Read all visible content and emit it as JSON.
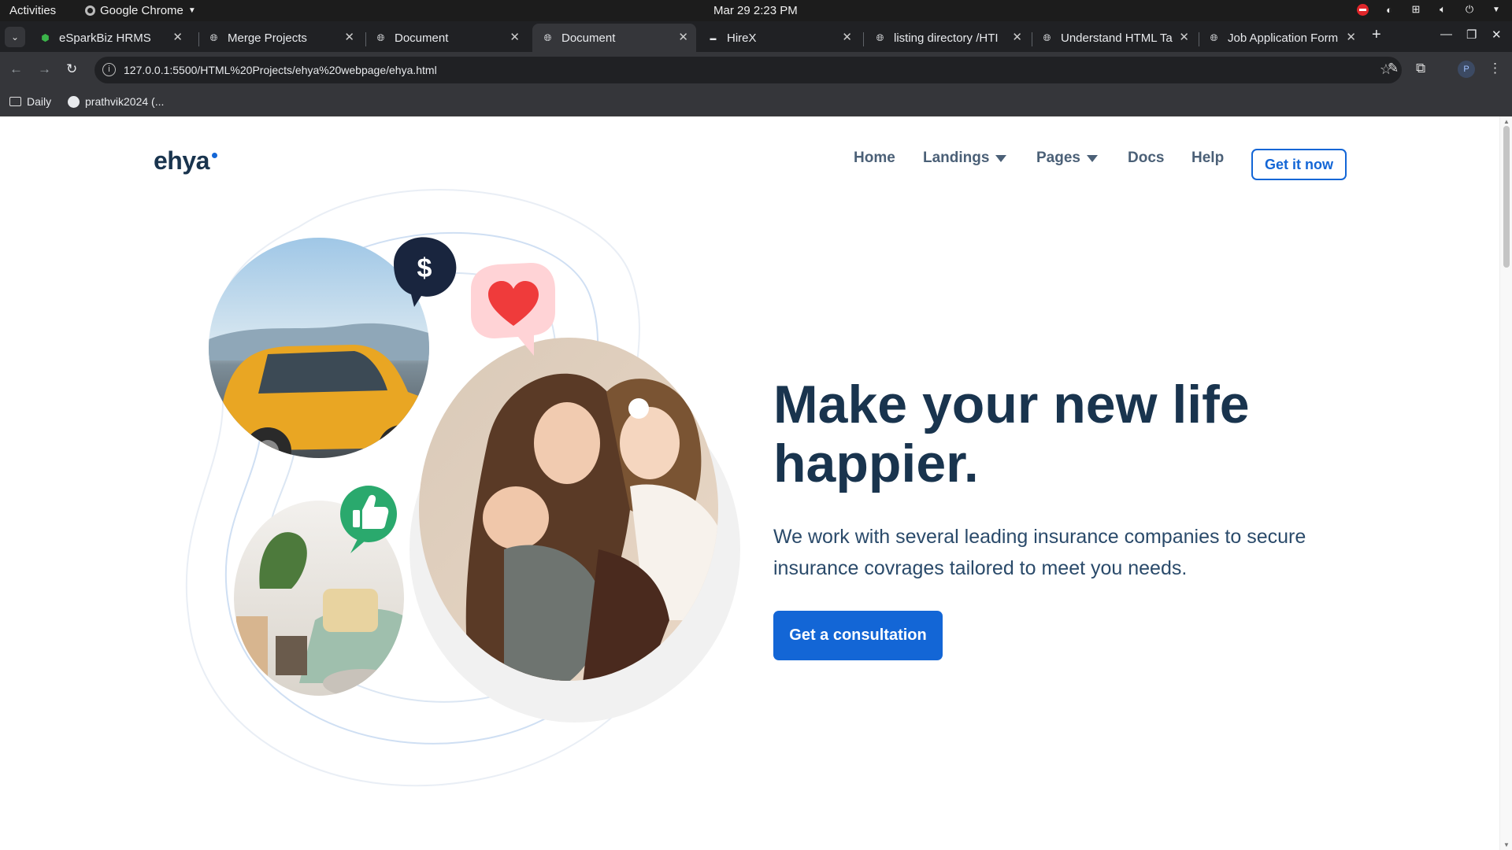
{
  "os": {
    "activities": "Activities",
    "app_name": "Google Chrome",
    "clock": "Mar 29  2:23 PM"
  },
  "browser": {
    "tabs": [
      {
        "title": "eSparkBiz HRMS",
        "icon": "esparkbiz-favicon",
        "active": false
      },
      {
        "title": "Merge Projects",
        "icon": "globe-icon",
        "active": false
      },
      {
        "title": "Document",
        "icon": "globe-icon",
        "active": false
      },
      {
        "title": "Document",
        "icon": "globe-icon",
        "active": true
      },
      {
        "title": "HireX",
        "icon": "hirex-favicon",
        "active": false
      },
      {
        "title": "listing directory /HTI",
        "icon": "globe-icon",
        "active": false
      },
      {
        "title": "Understand HTML Ta",
        "icon": "globe-icon",
        "active": false
      },
      {
        "title": "Job Application Form",
        "icon": "globe-icon",
        "active": false
      }
    ],
    "url": "127.0.0.1:5500/HTML%20Projects/ehya%20webpage/ehya.html",
    "profile_initial": "P",
    "bookmarks": [
      {
        "label": "Daily",
        "icon": "folder-icon"
      },
      {
        "label": "prathvik2024 (...",
        "icon": "github-icon"
      }
    ]
  },
  "page": {
    "logo": "ehya",
    "nav": {
      "home": "Home",
      "landings": "Landings",
      "pages": "Pages",
      "docs": "Docs",
      "help": "Help"
    },
    "get_it_now": "Get it now",
    "hero": {
      "title": "Make your new life happier.",
      "description": "We work with several leading insurance companies to secure insurance covrages tailored to meet you needs.",
      "cta": "Get a consultation"
    },
    "colors": {
      "primary": "#1366d6",
      "heading": "#19344e",
      "nav": "#4b6077",
      "dollar_bubble": "#19253e",
      "heart_bubble": "#ffd3d6",
      "heart": "#ef3b3b",
      "thumb_bubble": "#2aa96d"
    }
  }
}
